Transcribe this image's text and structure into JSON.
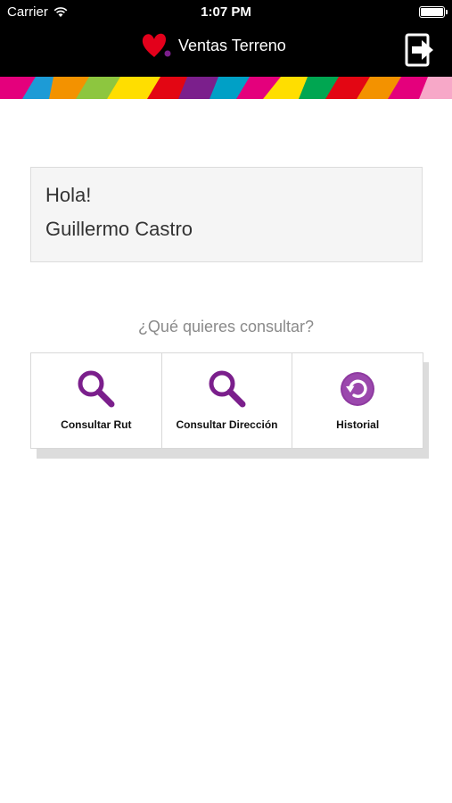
{
  "status_bar": {
    "carrier": "Carrier",
    "time": "1:07 PM",
    "icons": [
      "wifi-icon",
      "battery-icon"
    ]
  },
  "navbar": {
    "title": "Ventas Terreno",
    "logo_icon": "heart-logo-icon",
    "exit_icon": "logout-icon"
  },
  "greeting": {
    "hello": "Hola!",
    "user_name": "Guillermo Castro"
  },
  "prompt": "¿Qué quieres consultar?",
  "tiles": [
    {
      "label": "Consultar Rut",
      "icon": "search-icon"
    },
    {
      "label": "Consultar Dirección",
      "icon": "search-icon"
    },
    {
      "label": "Historial",
      "icon": "history-icon"
    }
  ],
  "colors": {
    "bar_background": "#000000",
    "accent_purple": "#7b1f8c",
    "logo_red": "#e3001b",
    "greeting_bg": "#f5f5f5"
  }
}
